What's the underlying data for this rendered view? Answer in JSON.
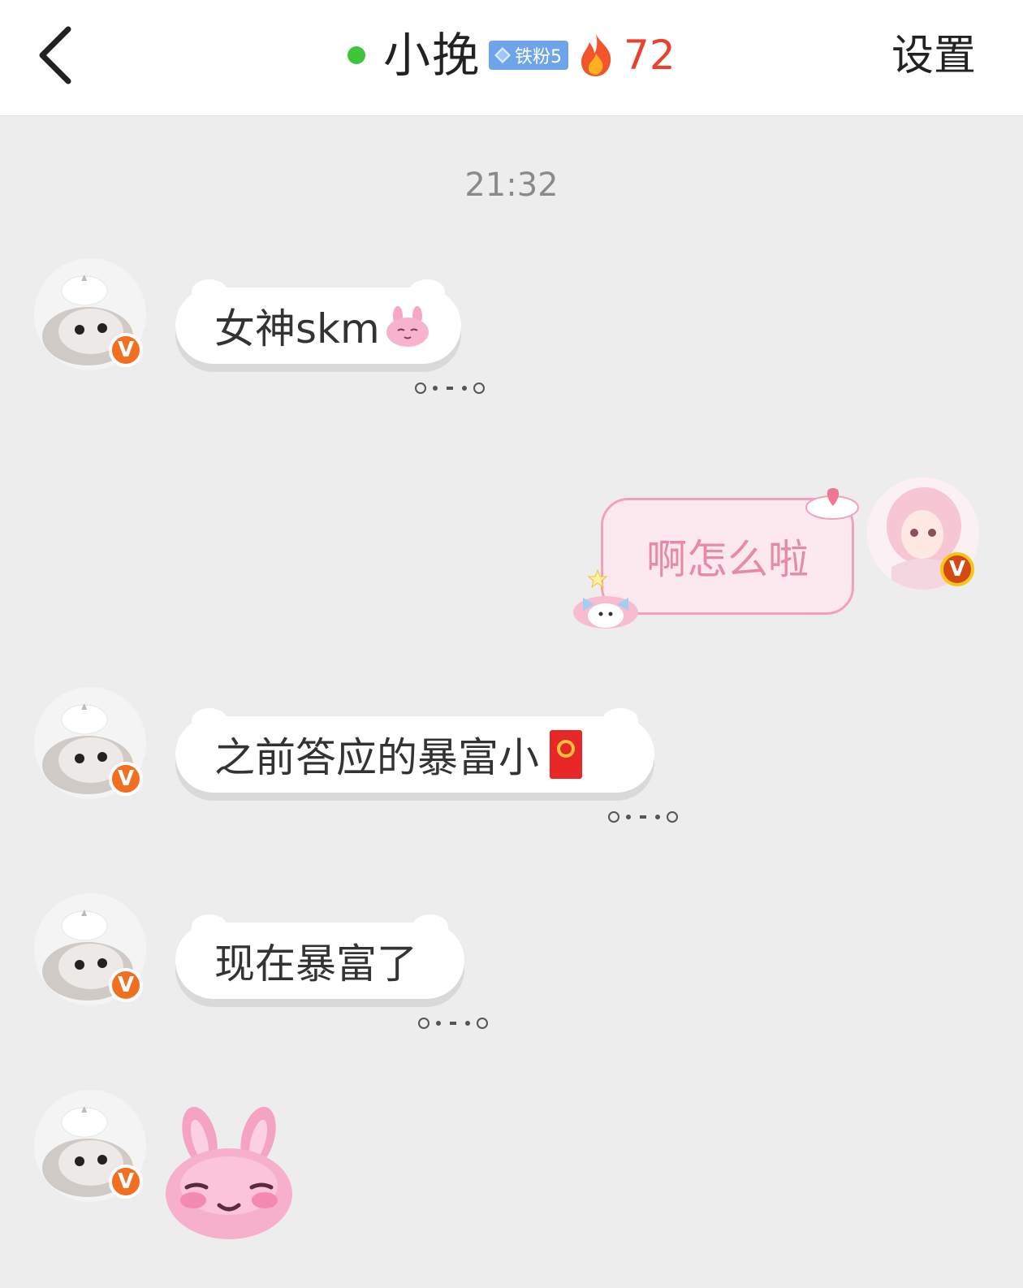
{
  "header": {
    "nickname": "小挽",
    "fan_badge": "铁粉5",
    "fire_count": "72",
    "settings_label": "设置"
  },
  "chat": {
    "timestamp": "21:32",
    "messages": [
      {
        "side": "left",
        "text": "女神skm"
      },
      {
        "side": "right",
        "text": "啊怎么啦"
      },
      {
        "side": "left",
        "text": "之前答应的暴富小"
      },
      {
        "side": "left",
        "text": "现在暴富了"
      }
    ]
  },
  "icons": {
    "back": "chevron-left-icon",
    "online": "online-dot",
    "fan": "diamond-icon",
    "fire": "fire-icon",
    "verified": "v-badge-icon",
    "bunny": "pink-bunny-emoji",
    "red_packet": "red-packet-icon",
    "verified_label": "V"
  },
  "colors": {
    "online": "#3ec63a",
    "fire_count": "#e8412e",
    "fan_badge": "#6ea4ea",
    "right_bubble_bg": "#fce8ef",
    "right_bubble_border": "#f2a2b8",
    "right_bubble_text": "#e78aa4",
    "verified": "#f07020"
  }
}
